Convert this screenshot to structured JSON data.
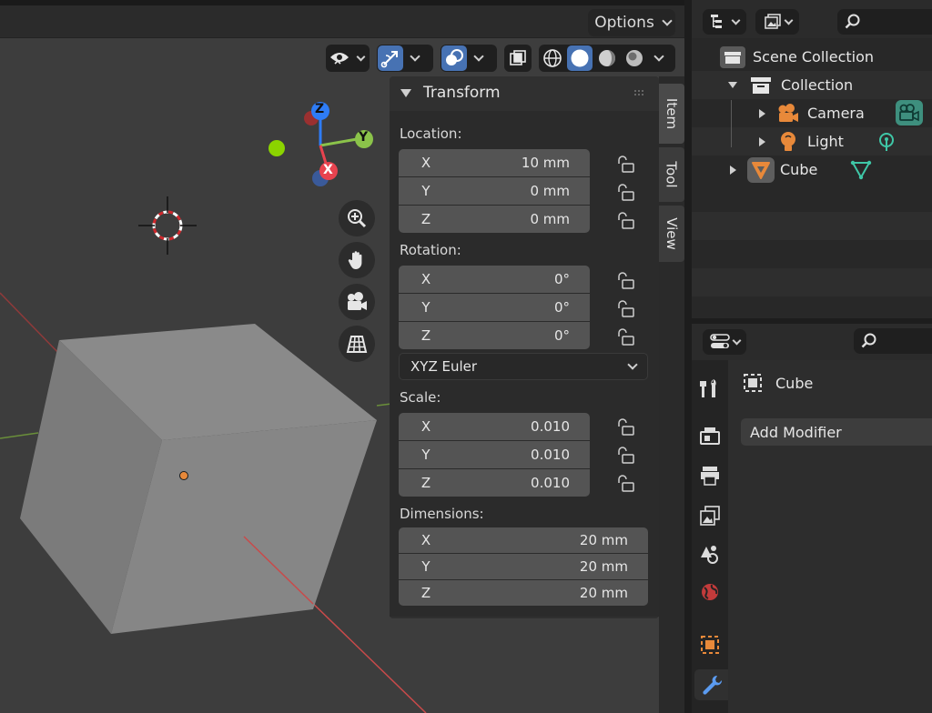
{
  "viewport": {
    "options_label": "Options",
    "gizmo": {
      "x": "X",
      "y": "Y",
      "z": "Z"
    }
  },
  "npanel": {
    "panel_title": "Transform",
    "location": {
      "label": "Location:",
      "x": "10 mm",
      "y": "0 mm",
      "z": "0 mm"
    },
    "rotation": {
      "label": "Rotation:",
      "x": "0°",
      "y": "0°",
      "z": "0°",
      "mode": "XYZ Euler"
    },
    "scale": {
      "label": "Scale:",
      "x": "0.010",
      "y": "0.010",
      "z": "0.010"
    },
    "dimensions": {
      "label": "Dimensions:",
      "x": "20 mm",
      "y": "20 mm",
      "z": "20 mm"
    },
    "axes": {
      "x": "X",
      "y": "Y",
      "z": "Z"
    },
    "tabs": [
      "Item",
      "Tool",
      "View"
    ]
  },
  "outliner": {
    "items": [
      {
        "label": "Scene Collection"
      },
      {
        "label": "Collection"
      },
      {
        "label": "Camera"
      },
      {
        "label": "Light"
      },
      {
        "label": "Cube"
      }
    ]
  },
  "properties": {
    "object_name": "Cube",
    "add_modifier_label": "Add Modifier"
  },
  "colors": {
    "accent_blue": "#4772b3",
    "axis_x": "#e8434f",
    "axis_y": "#8bc34a",
    "axis_z": "#2e7cf6",
    "object_orange": "#e8893a"
  }
}
